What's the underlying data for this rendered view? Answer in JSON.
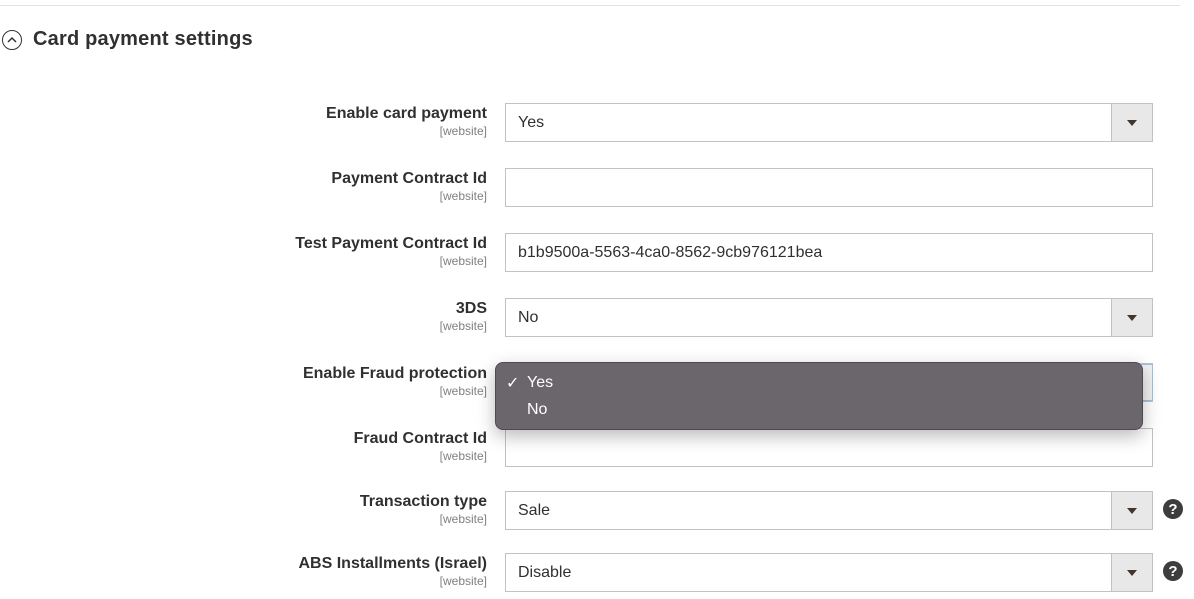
{
  "section": {
    "title": "Card payment settings",
    "toggle_icon": "chevron-up-circle-icon",
    "expanded": true
  },
  "fields": [
    {
      "label": "Enable card payment",
      "scope": "[website]",
      "type": "select",
      "value": "Yes",
      "help": false
    },
    {
      "label": "Payment Contract Id",
      "scope": "[website]",
      "type": "text",
      "value": "",
      "help": false
    },
    {
      "label": "Test Payment Contract Id",
      "scope": "[website]",
      "type": "text",
      "value": "b1b9500a-5563-4ca0-8562-9cb976121bea",
      "help": false
    },
    {
      "label": "3DS",
      "scope": "[website]",
      "type": "select",
      "value": "No",
      "help": false
    },
    {
      "label": "Enable Fraud protection",
      "scope": "[website]",
      "type": "select",
      "value": "Yes",
      "help": false,
      "open": true
    },
    {
      "label": "Fraud Contract Id",
      "scope": "[website]",
      "type": "text",
      "value": "",
      "help": false
    },
    {
      "label": "Transaction type",
      "scope": "[website]",
      "type": "select",
      "value": "Sale",
      "help": true
    },
    {
      "label": "ABS Installments (Israel)",
      "scope": "[website]",
      "type": "select",
      "value": "Disable",
      "help": true
    }
  ],
  "dropdown": {
    "options": [
      {
        "label": "Yes",
        "selected": true,
        "check": "✓"
      },
      {
        "label": "No",
        "selected": false,
        "check": ""
      }
    ]
  },
  "help_icon_glyph": "?"
}
